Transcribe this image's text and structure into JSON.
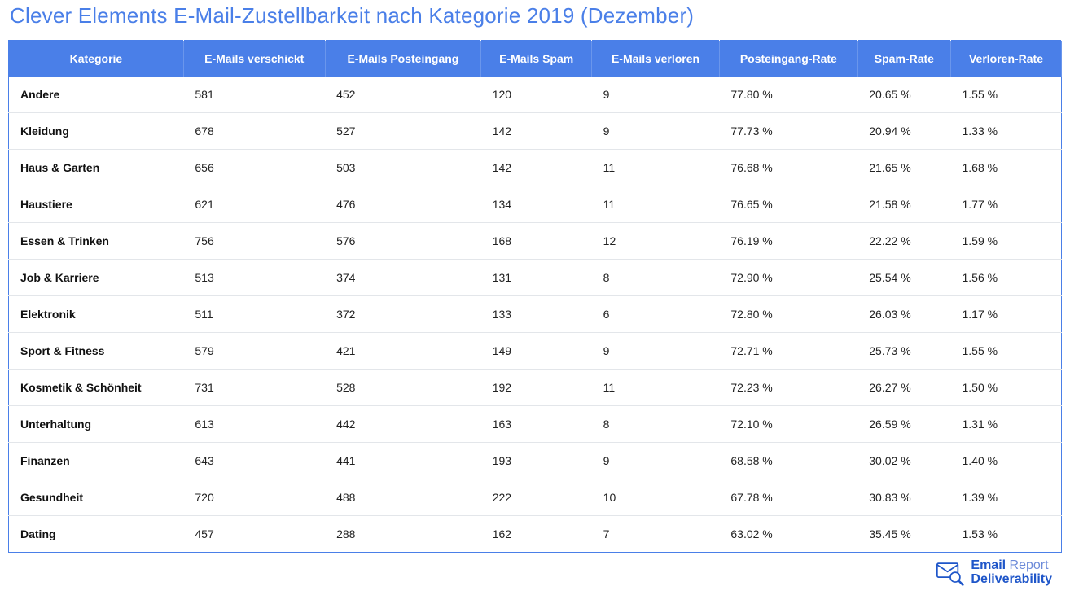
{
  "title": "Clever Elements E-Mail-Zustellbarkeit nach Kategorie 2019 (Dezember)",
  "columns": [
    "Kategorie",
    "E-Mails verschickt",
    "E-Mails Posteingang",
    "E-Mails Spam",
    "E-Mails verloren",
    "Posteingang-Rate",
    "Spam-Rate",
    "Verloren-Rate"
  ],
  "rows": [
    {
      "cat": "Andere",
      "sent": "581",
      "inbox": "452",
      "spam": "120",
      "lost": "9",
      "inbox_rate": "77.80 %",
      "spam_rate": "20.65 %",
      "lost_rate": "1.55 %"
    },
    {
      "cat": "Kleidung",
      "sent": "678",
      "inbox": "527",
      "spam": "142",
      "lost": "9",
      "inbox_rate": "77.73 %",
      "spam_rate": "20.94 %",
      "lost_rate": "1.33 %"
    },
    {
      "cat": "Haus & Garten",
      "sent": "656",
      "inbox": "503",
      "spam": "142",
      "lost": "11",
      "inbox_rate": "76.68 %",
      "spam_rate": "21.65 %",
      "lost_rate": "1.68 %"
    },
    {
      "cat": "Haustiere",
      "sent": "621",
      "inbox": "476",
      "spam": "134",
      "lost": "11",
      "inbox_rate": "76.65 %",
      "spam_rate": "21.58 %",
      "lost_rate": "1.77 %"
    },
    {
      "cat": "Essen & Trinken",
      "sent": "756",
      "inbox": "576",
      "spam": "168",
      "lost": "12",
      "inbox_rate": "76.19 %",
      "spam_rate": "22.22 %",
      "lost_rate": "1.59 %"
    },
    {
      "cat": "Job & Karriere",
      "sent": "513",
      "inbox": "374",
      "spam": "131",
      "lost": "8",
      "inbox_rate": "72.90 %",
      "spam_rate": "25.54 %",
      "lost_rate": "1.56 %"
    },
    {
      "cat": "Elektronik",
      "sent": "511",
      "inbox": "372",
      "spam": "133",
      "lost": "6",
      "inbox_rate": "72.80 %",
      "spam_rate": "26.03 %",
      "lost_rate": "1.17 %"
    },
    {
      "cat": "Sport & Fitness",
      "sent": "579",
      "inbox": "421",
      "spam": "149",
      "lost": "9",
      "inbox_rate": "72.71 %",
      "spam_rate": "25.73 %",
      "lost_rate": "1.55 %"
    },
    {
      "cat": "Kosmetik & Schönheit",
      "sent": "731",
      "inbox": "528",
      "spam": "192",
      "lost": "11",
      "inbox_rate": "72.23 %",
      "spam_rate": "26.27 %",
      "lost_rate": "1.50 %"
    },
    {
      "cat": "Unterhaltung",
      "sent": "613",
      "inbox": "442",
      "spam": "163",
      "lost": "8",
      "inbox_rate": "72.10 %",
      "spam_rate": "26.59 %",
      "lost_rate": "1.31 %"
    },
    {
      "cat": "Finanzen",
      "sent": "643",
      "inbox": "441",
      "spam": "193",
      "lost": "9",
      "inbox_rate": "68.58 %",
      "spam_rate": "30.02 %",
      "lost_rate": "1.40 %"
    },
    {
      "cat": "Gesundheit",
      "sent": "720",
      "inbox": "488",
      "spam": "222",
      "lost": "10",
      "inbox_rate": "67.78 %",
      "spam_rate": "30.83 %",
      "lost_rate": "1.39 %"
    },
    {
      "cat": "Dating",
      "sent": "457",
      "inbox": "288",
      "spam": "162",
      "lost": "7",
      "inbox_rate": "63.02 %",
      "spam_rate": "35.45 %",
      "lost_rate": "1.53 %"
    }
  ],
  "brand": {
    "line1_strong": "Email",
    "line1_light": "Report",
    "line2": "Deliverability"
  },
  "chart_data": {
    "type": "table",
    "title": "Clever Elements E-Mail-Zustellbarkeit nach Kategorie 2019 (Dezember)",
    "columns": [
      "Kategorie",
      "E-Mails verschickt",
      "E-Mails Posteingang",
      "E-Mails Spam",
      "E-Mails verloren",
      "Posteingang-Rate",
      "Spam-Rate",
      "Verloren-Rate"
    ],
    "data": [
      [
        "Andere",
        581,
        452,
        120,
        9,
        77.8,
        20.65,
        1.55
      ],
      [
        "Kleidung",
        678,
        527,
        142,
        9,
        77.73,
        20.94,
        1.33
      ],
      [
        "Haus & Garten",
        656,
        503,
        142,
        11,
        76.68,
        21.65,
        1.68
      ],
      [
        "Haustiere",
        621,
        476,
        134,
        11,
        76.65,
        21.58,
        1.77
      ],
      [
        "Essen & Trinken",
        756,
        576,
        168,
        12,
        76.19,
        22.22,
        1.59
      ],
      [
        "Job & Karriere",
        513,
        374,
        131,
        8,
        72.9,
        25.54,
        1.56
      ],
      [
        "Elektronik",
        511,
        372,
        133,
        6,
        72.8,
        26.03,
        1.17
      ],
      [
        "Sport & Fitness",
        579,
        421,
        149,
        9,
        72.71,
        25.73,
        1.55
      ],
      [
        "Kosmetik & Schönheit",
        731,
        528,
        192,
        11,
        72.23,
        26.27,
        1.5
      ],
      [
        "Unterhaltung",
        613,
        442,
        163,
        8,
        72.1,
        26.59,
        1.31
      ],
      [
        "Finanzen",
        643,
        441,
        193,
        9,
        68.58,
        30.02,
        1.4
      ],
      [
        "Gesundheit",
        720,
        488,
        222,
        10,
        67.78,
        30.83,
        1.39
      ],
      [
        "Dating",
        457,
        288,
        162,
        7,
        63.02,
        35.45,
        1.53
      ]
    ],
    "rate_unit": "percent"
  }
}
